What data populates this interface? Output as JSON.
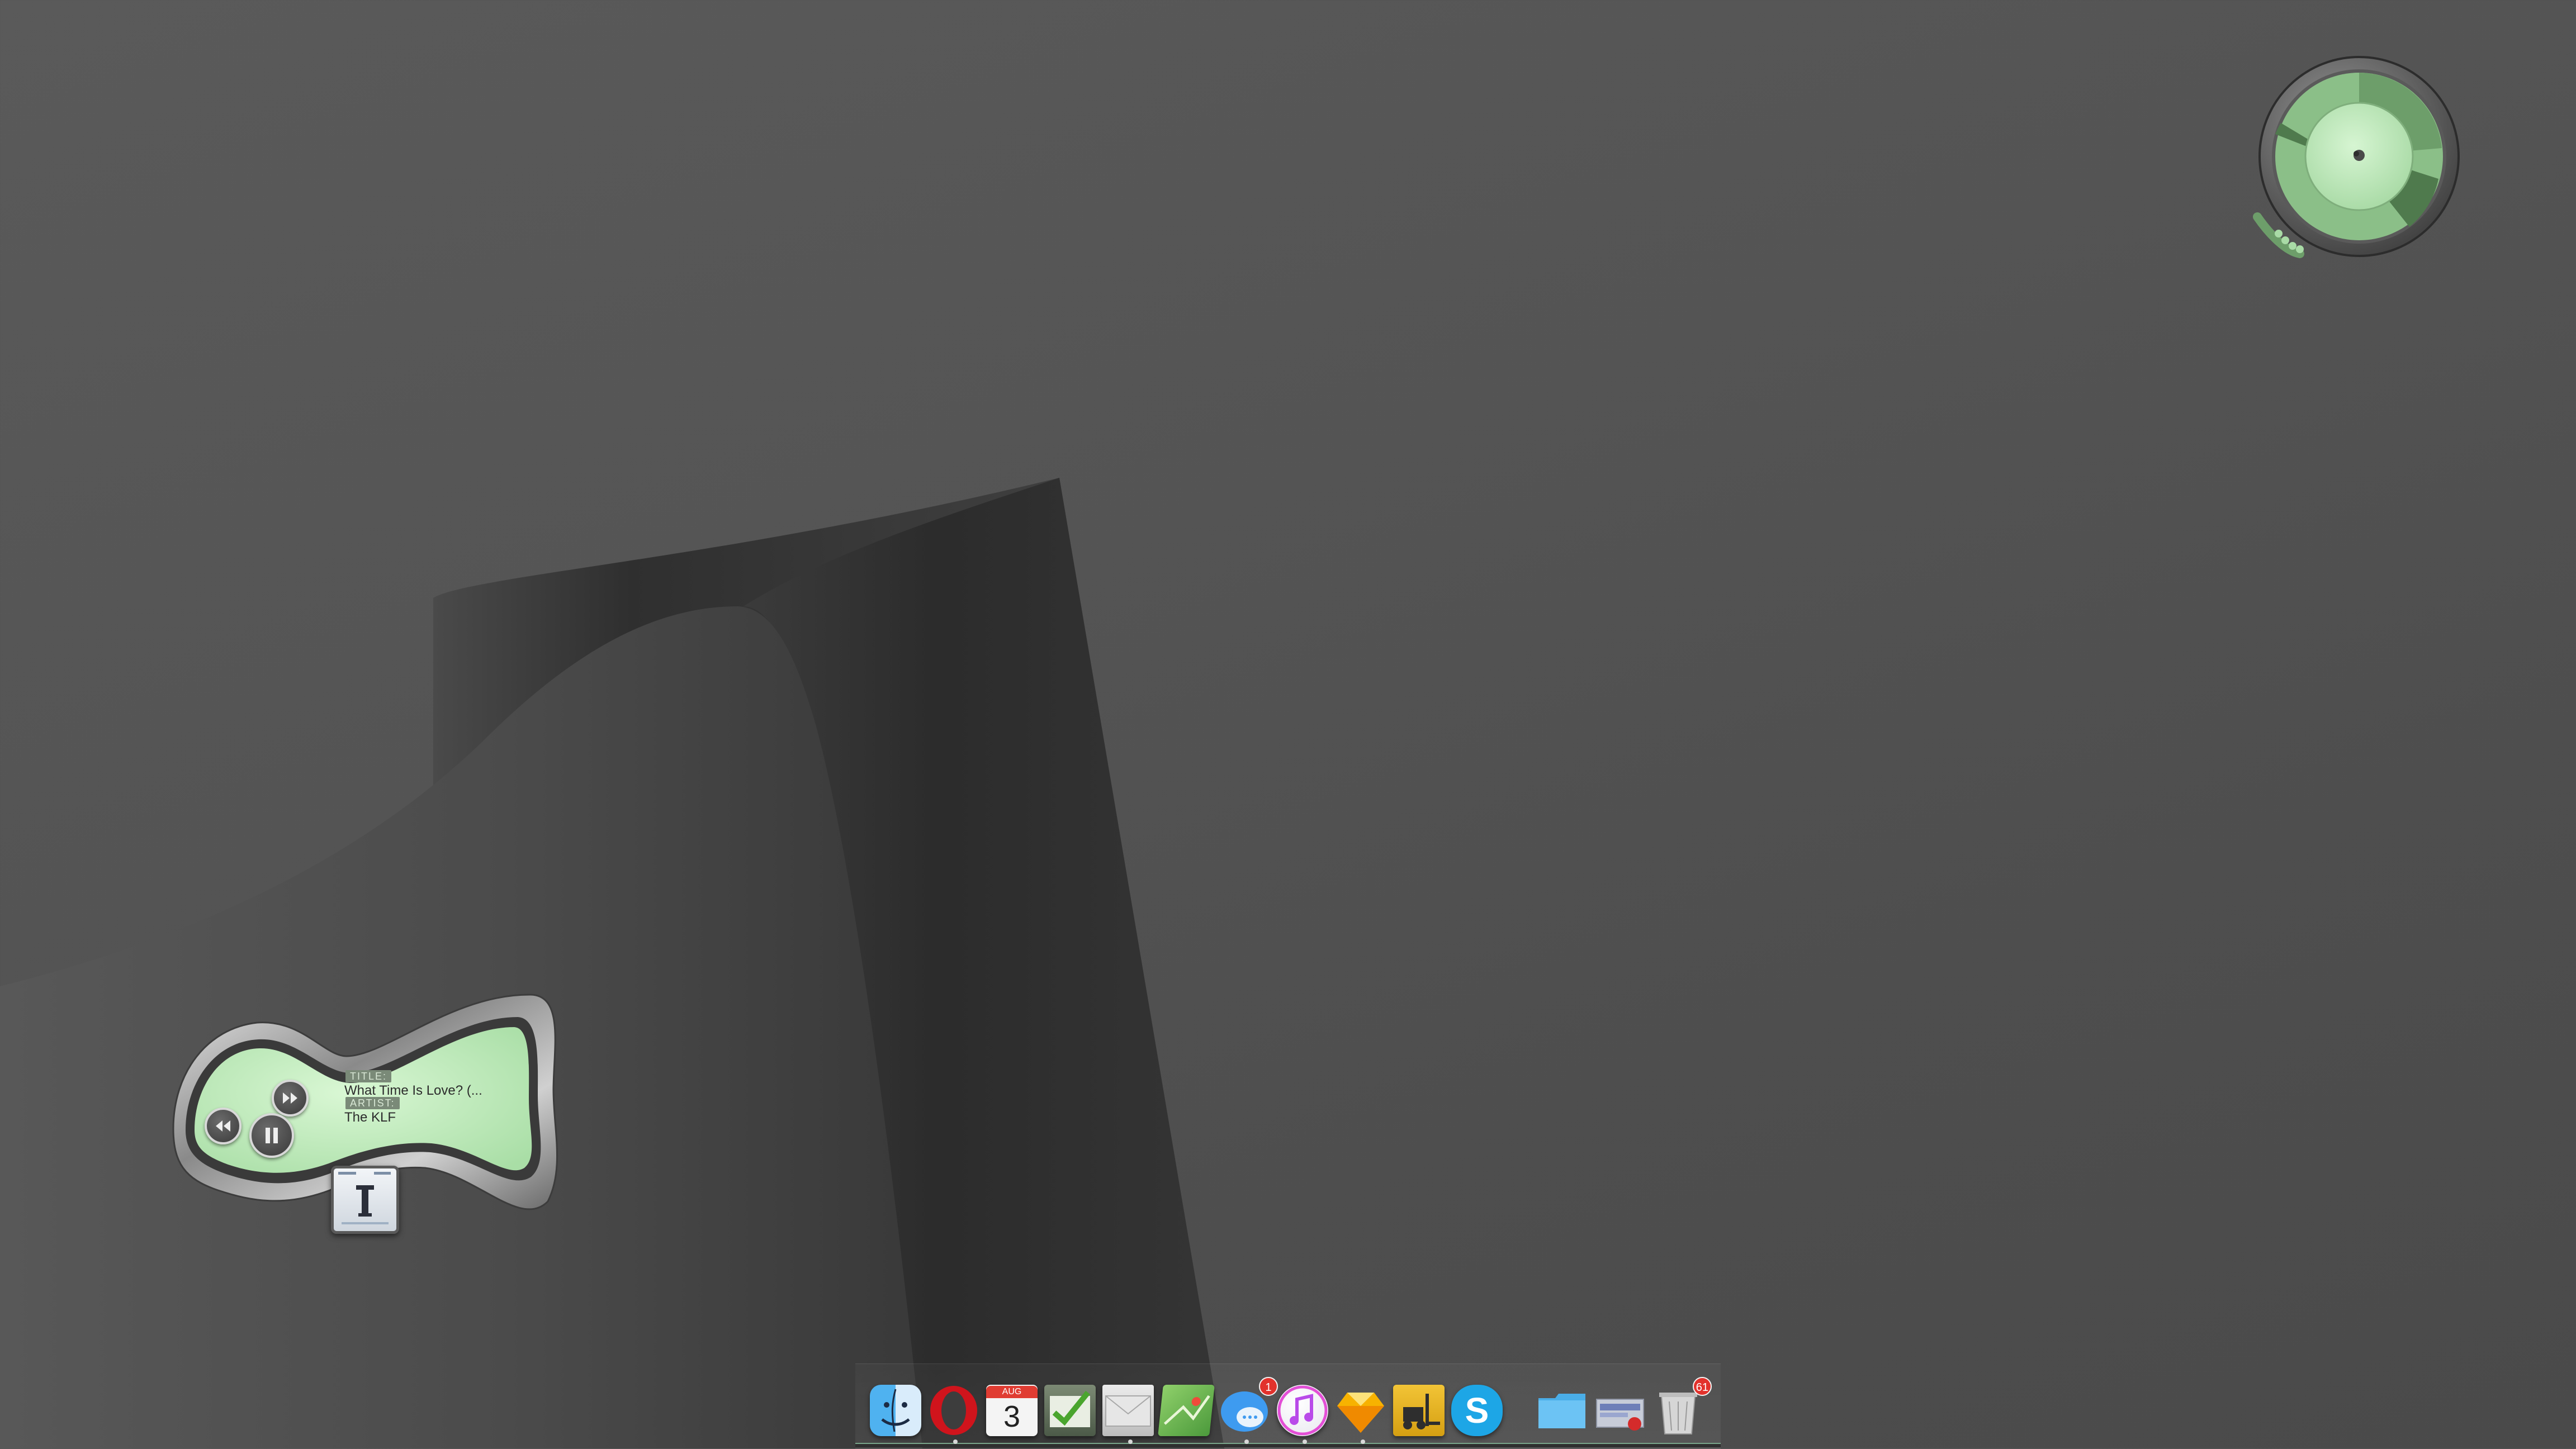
{
  "music_player": {
    "title_label": "TITLE:",
    "title": "What Time Is Love? (...",
    "artist_label": "ARTIST:",
    "artist": "The KLF",
    "state": "playing",
    "controls": [
      "previous",
      "play-pause",
      "next"
    ]
  },
  "clock_widget": {
    "icon": "clock-dial-icon"
  },
  "dock": {
    "items": [
      {
        "name": "Finder",
        "icon": "finder-icon"
      },
      {
        "name": "Opera",
        "icon": "opera-icon"
      },
      {
        "name": "Calendar",
        "icon": "calendar-icon",
        "month": "AUG",
        "day": "3"
      },
      {
        "name": "Tasks",
        "icon": "checklist-icon"
      },
      {
        "name": "Mail",
        "icon": "mail-icon"
      },
      {
        "name": "Maps",
        "icon": "map-icon"
      },
      {
        "name": "Messages",
        "icon": "messages-icon",
        "badge": "1"
      },
      {
        "name": "iTunes",
        "icon": "music-note-icon"
      },
      {
        "name": "Sketch",
        "icon": "sketch-icon"
      },
      {
        "name": "Transmit",
        "icon": "forklift-icon"
      },
      {
        "name": "Skype",
        "icon": "skype-icon",
        "letter": "S"
      },
      {
        "name": "Folder",
        "icon": "folder-icon"
      },
      {
        "name": "Downloads",
        "icon": "downloads-stack-icon"
      },
      {
        "name": "Trash",
        "icon": "trash-icon",
        "badge": "61"
      }
    ]
  },
  "colors": {
    "widget_green": "#c6f0c4",
    "widget_chrome": "#5c5c5c",
    "dock_accent": "#79a58a",
    "badge_red": "#e2322c"
  }
}
